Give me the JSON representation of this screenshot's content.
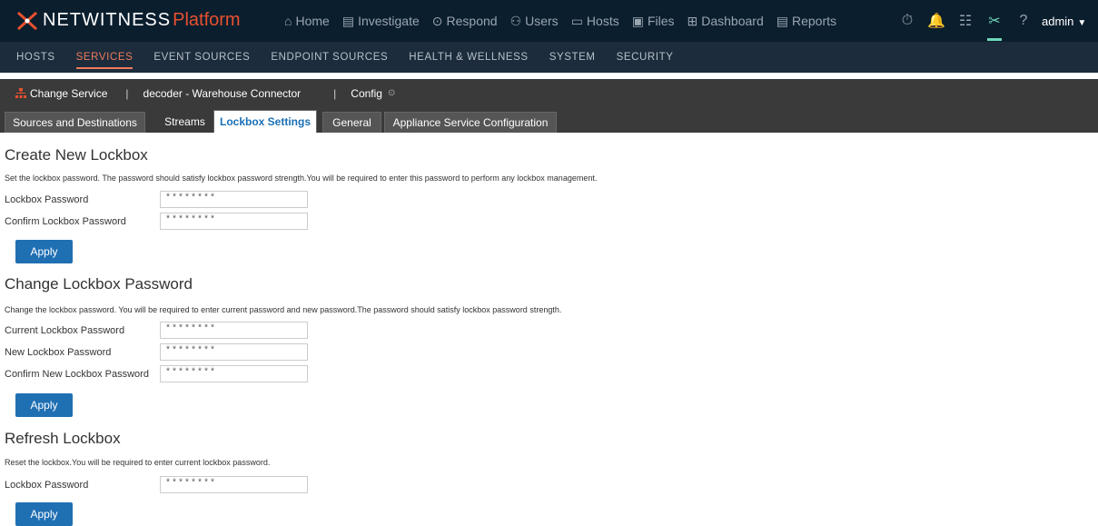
{
  "brand": {
    "name": "NETWITNESS",
    "platform": "Platform"
  },
  "topnav": [
    {
      "icon": "⌂",
      "label": "Home"
    },
    {
      "icon": "▤",
      "label": "Investigate"
    },
    {
      "icon": "⊙",
      "label": "Respond"
    },
    {
      "icon": "⚇",
      "label": "Users"
    },
    {
      "icon": "▭",
      "label": "Hosts"
    },
    {
      "icon": "▣",
      "label": "Files"
    },
    {
      "icon": "⊞",
      "label": "Dashboard"
    },
    {
      "icon": "▤",
      "label": "Reports"
    }
  ],
  "tools": {
    "timer": "⏱",
    "bell": "🔔",
    "notes": "☷",
    "admin_tools": "✂",
    "help": "?",
    "user": "admin"
  },
  "subnav": [
    "HOSTS",
    "SERVICES",
    "EVENT SOURCES",
    "ENDPOINT SOURCES",
    "HEALTH & WELLNESS",
    "SYSTEM",
    "SECURITY"
  ],
  "service_bar": {
    "change_service": "Change Service",
    "service_name": "decoder - Warehouse Connector",
    "config": "Config"
  },
  "tabs": [
    "Sources and Destinations",
    "Streams",
    "Lockbox Settings",
    "General",
    "Appliance Service Configuration"
  ],
  "create": {
    "title": "Create New Lockbox",
    "desc": "Set the lockbox password. The password should satisfy lockbox password strength.You will be required to enter this password to perform any lockbox management.",
    "fields": [
      {
        "label": "Lockbox Password",
        "value": "********"
      },
      {
        "label": "Confirm Lockbox Password",
        "value": "********"
      }
    ],
    "apply": "Apply"
  },
  "change": {
    "title": "Change Lockbox Password",
    "desc": "Change the lockbox password. You will be required to enter current password and new password.The password should satisfy lockbox password strength.",
    "fields": [
      {
        "label": "Current Lockbox Password",
        "value": "********"
      },
      {
        "label": "New Lockbox Password",
        "value": "********"
      },
      {
        "label": "Confirm New Lockbox Password",
        "value": "********"
      }
    ],
    "apply": "Apply"
  },
  "refresh": {
    "title": "Refresh Lockbox",
    "desc": "Reset the lockbox.You will be required to enter current lockbox password.",
    "fields": [
      {
        "label": "Lockbox Password",
        "value": "********"
      }
    ],
    "apply": "Apply"
  }
}
